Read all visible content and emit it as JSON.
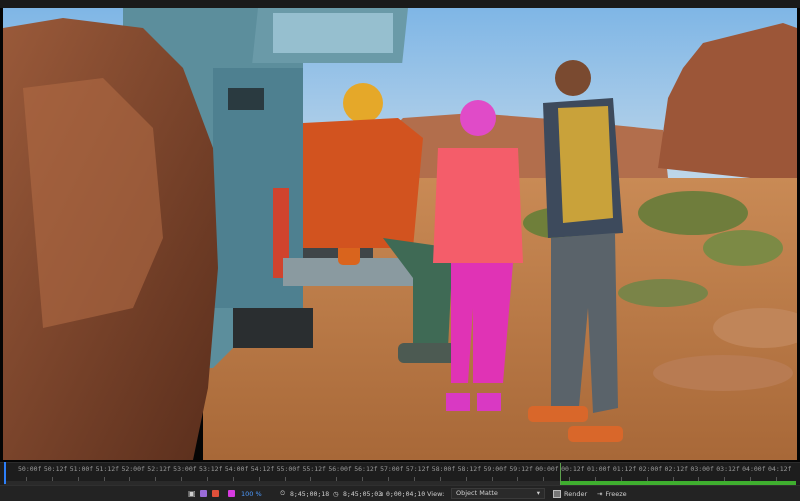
{
  "timeline": {
    "ticks": [
      "50:00f",
      "50:12f",
      "51:00f",
      "51:12f",
      "52:00f",
      "52:12f",
      "53:00f",
      "53:12f",
      "54:00f",
      "54:12f",
      "55:00f",
      "55:12f",
      "56:00f",
      "56:12f",
      "57:00f",
      "57:12f",
      "58:00f",
      "58:12f",
      "59:00f",
      "59:12f",
      "00:00f",
      "00:12f",
      "01:00f",
      "01:12f",
      "02:00f",
      "02:12f",
      "03:00f",
      "03:12f",
      "04:00f",
      "04:12f"
    ]
  },
  "controls": {
    "zoom": "100 %",
    "current_time": "8;45;00;18",
    "start_time": "8;45;05;03",
    "duration": "0;00;04;10",
    "view_label": "View:",
    "view_value": "Object Matte",
    "render_label": "Render",
    "freeze_label": "Freeze"
  },
  "colors": {
    "accent": "#2d7ff9",
    "work_area": "#3fae2f",
    "swatch_purple": "#9a6bd8",
    "swatch_red": "#e0503a",
    "swatch_magenta": "#d63ae0"
  },
  "icons": {
    "camera": "camera-icon",
    "snapshot": "snapshot-icon",
    "timecode": "clock-icon",
    "eye": "eye-icon"
  }
}
